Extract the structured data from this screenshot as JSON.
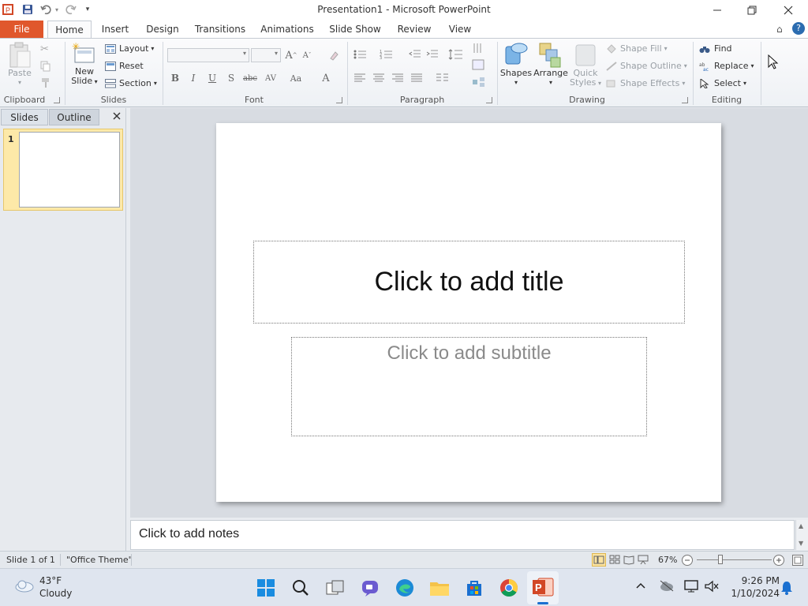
{
  "window": {
    "title": "Presentation1 - Microsoft PowerPoint",
    "minimize_icon": "minimize-icon",
    "maximize_icon": "restore-icon",
    "close_icon": "close-icon"
  },
  "qat": [
    "powerpoint-logo-icon",
    "save-icon",
    "undo-icon",
    "redo-icon",
    "customize-qat-icon"
  ],
  "tabs": {
    "file": "File",
    "items": [
      "Home",
      "Insert",
      "Design",
      "Transitions",
      "Animations",
      "Slide Show",
      "Review",
      "View"
    ],
    "active": "Home"
  },
  "ribbon": {
    "clipboard": {
      "paste": "Paste",
      "label": "Clipboard"
    },
    "slides": {
      "new_slide_1": "New",
      "new_slide_2": "Slide",
      "layout": "Layout",
      "reset": "Reset",
      "section": "Section",
      "label": "Slides"
    },
    "font": {
      "label": "Font",
      "bold": "B",
      "italic": "I",
      "underline": "U",
      "shadow": "S",
      "strike": "abc",
      "spacing": "AV",
      "case": "Aa",
      "color": "A",
      "grow": "A",
      "shrink": "A"
    },
    "paragraph": {
      "label": "Paragraph"
    },
    "drawing": {
      "shapes": "Shapes",
      "arrange": "Arrange",
      "quick_styles_1": "Quick",
      "quick_styles_2": "Styles",
      "shape_fill": "Shape Fill",
      "shape_outline": "Shape Outline",
      "shape_effects": "Shape Effects",
      "label": "Drawing"
    },
    "editing": {
      "find": "Find",
      "replace": "Replace",
      "select": "Select",
      "label": "Editing"
    }
  },
  "panel": {
    "tab_slides": "Slides",
    "tab_outline": "Outline",
    "slide_number": "1"
  },
  "slide": {
    "title_placeholder": "Click to add title",
    "subtitle_placeholder": "Click to add subtitle"
  },
  "notes": {
    "placeholder": "Click to add notes"
  },
  "status": {
    "slide_info": "Slide 1 of 1",
    "theme": "\"Office Theme\"",
    "zoom": "67%",
    "zoom_level": 0.67
  },
  "taskbar": {
    "weather_temp": "43°F",
    "weather_desc": "Cloudy",
    "time": "9:26 PM",
    "date": "1/10/2024",
    "apps": [
      "windows-start-icon",
      "search-icon",
      "task-view-icon",
      "teams-chat-icon",
      "edge-icon",
      "file-explorer-icon",
      "microsoft-store-icon",
      "chrome-icon",
      "powerpoint-icon"
    ]
  },
  "colors": {
    "file_tab": "#e0572c",
    "thumb_selected": "#fde9a8",
    "accent": "#2b6cb0"
  }
}
